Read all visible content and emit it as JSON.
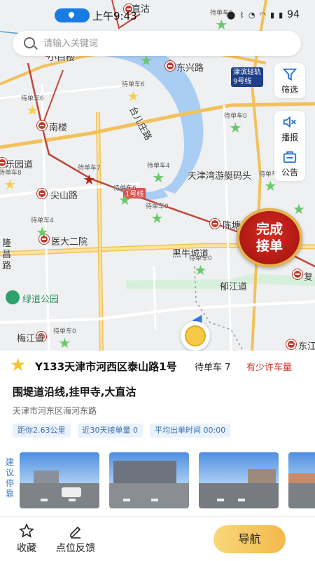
{
  "status_bar": {
    "time": "上午9:43",
    "icons": [
      "location-icon",
      "bluetooth-icon",
      "mute-icon",
      "alarm-icon",
      "wifi-icon",
      "signal-icon",
      "battery-icon"
    ],
    "battery": "94"
  },
  "search": {
    "placeholder": "请输入关键词"
  },
  "map": {
    "place_labels": {
      "zhigu": "直沽",
      "xiaobaolou": "小白楼",
      "dongxing_road": "东兴路",
      "tianjin_metro": "津滨轻轨9号线",
      "nanlou": "南楼",
      "taierzhuang_road": "台儿庄路",
      "leyuan_road": "乐园道",
      "jianshan_road": "尖山路",
      "tianjin_bay": "天津湾游艇码头",
      "chentang": "陈塘",
      "yida_eryuan": "医大二院",
      "longchang_road": "隆昌路",
      "heiniucheng_road": "黑牛城道",
      "lvdao_park": "绿道公园",
      "yujiang_road": "郁江道",
      "meijiang_road": "梅江道",
      "fu": "复",
      "dongjiang": "东江",
      "line_one": "1号线"
    },
    "pin_label": "待单车",
    "pins": [
      {
        "name": "pin-6a",
        "label": "待单车6"
      },
      {
        "name": "pin-6b",
        "label": "待单车6"
      },
      {
        "name": "pin-8",
        "label": "待单车8"
      },
      {
        "name": "pin-0a",
        "label": "待单车0"
      },
      {
        "name": "pin-7",
        "label": "待单车7"
      },
      {
        "name": "pin-4a",
        "label": "待单车4"
      },
      {
        "name": "pin-6c",
        "label": "待单车6"
      },
      {
        "name": "pin-4b",
        "label": "待单车4"
      },
      {
        "name": "pin-0b",
        "label": "待单车0"
      },
      {
        "name": "pin-0c",
        "label": "待单车0"
      },
      {
        "name": "pin-0d",
        "label": "待单车0"
      },
      {
        "name": "pin-0e",
        "label": "待单车0"
      },
      {
        "name": "pin-0f",
        "label": "待单车0"
      }
    ],
    "tools": {
      "filter": "筛选",
      "broadcast": "播报",
      "announcement": "公告"
    },
    "complete_badge": "完成接单"
  },
  "spot": {
    "name": "Y133天津市河西区泰山路1号",
    "pending": "待单车 7",
    "availability": "有少许车量",
    "roads": "围堤道沿线,挂甲寺,大直沽",
    "address": "天津市河东区海河东路",
    "stats": {
      "distance": "距你2.63公里",
      "recent_orders": "近30天接单量 0",
      "avg_time": "平均出单时间 00:00"
    },
    "suggest_label": "建议停靠"
  },
  "bottom": {
    "favorite": "收藏",
    "feedback": "点位反馈",
    "navigate": "导航"
  },
  "colors": {
    "accent_blue": "#1a7be0",
    "badge_red": "#b21a14",
    "availability_red": "#d0342c",
    "nav_gold": "#f3b94b"
  }
}
